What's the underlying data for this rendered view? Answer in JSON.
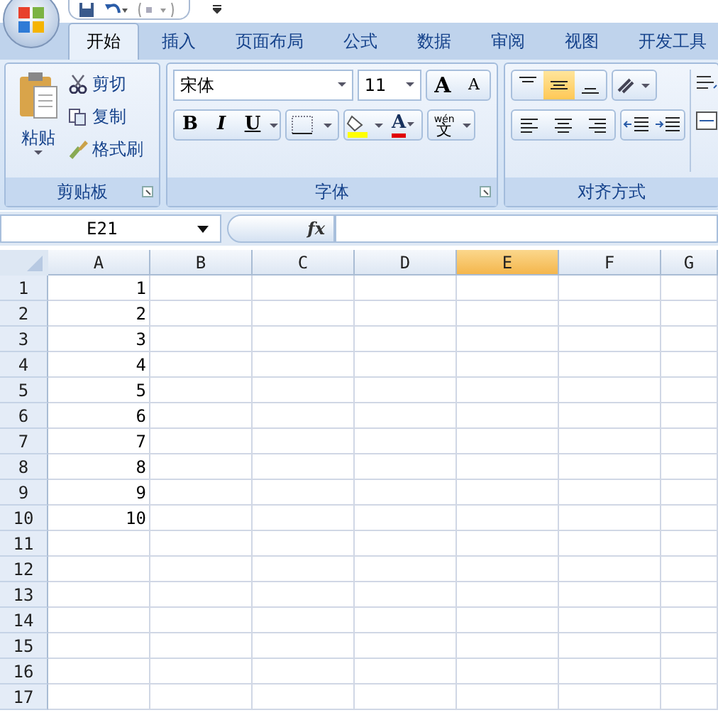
{
  "tabs": [
    {
      "label": "开始",
      "selected": true
    },
    {
      "label": "插入",
      "selected": false
    },
    {
      "label": "页面布局",
      "selected": false
    },
    {
      "label": "公式",
      "selected": false
    },
    {
      "label": "数据",
      "selected": false
    },
    {
      "label": "审阅",
      "selected": false
    },
    {
      "label": "视图",
      "selected": false
    },
    {
      "label": "开发工具",
      "selected": false
    }
  ],
  "clipboard": {
    "paste_label": "粘贴",
    "commands": [
      {
        "kind": "cut",
        "label": "剪切"
      },
      {
        "kind": "copy",
        "label": "复制"
      },
      {
        "kind": "painter",
        "label": "格式刷"
      }
    ],
    "title": "剪贴板"
  },
  "font": {
    "font_name": "宋体",
    "font_size": "11",
    "grow_label": "A",
    "shrink_label": "A",
    "styles": [
      {
        "kind": "bold",
        "label": "B"
      },
      {
        "kind": "italic",
        "label": "I"
      },
      {
        "kind": "underline",
        "label": "U"
      }
    ],
    "font_color_label": "A",
    "phonetic": {
      "ruby": "wén",
      "base": "文"
    },
    "title": "字体"
  },
  "alignment": {
    "vertical": [
      {
        "kind": "top",
        "selected": false
      },
      {
        "kind": "middle",
        "selected": true
      },
      {
        "kind": "bottom",
        "selected": false
      }
    ],
    "horizontal": [
      {
        "kind": "left"
      },
      {
        "kind": "center"
      },
      {
        "kind": "right"
      }
    ],
    "title": "对齐方式"
  },
  "formula_bar": {
    "name_box": "E21",
    "fx_label": "fx"
  },
  "sheet": {
    "columns": [
      {
        "label": "A",
        "selected": false
      },
      {
        "label": "B",
        "selected": false
      },
      {
        "label": "C",
        "selected": false
      },
      {
        "label": "D",
        "selected": false
      },
      {
        "label": "E",
        "selected": true
      },
      {
        "label": "F",
        "selected": false
      },
      {
        "label": "G",
        "selected": false
      }
    ],
    "rows": [
      {
        "header": "1",
        "cells": [
          "1"
        ]
      },
      {
        "header": "2",
        "cells": [
          "2"
        ]
      },
      {
        "header": "3",
        "cells": [
          "3"
        ]
      },
      {
        "header": "4",
        "cells": [
          "4"
        ]
      },
      {
        "header": "5",
        "cells": [
          "5"
        ]
      },
      {
        "header": "6",
        "cells": [
          "6"
        ]
      },
      {
        "header": "7",
        "cells": [
          "7"
        ]
      },
      {
        "header": "8",
        "cells": [
          "8"
        ]
      },
      {
        "header": "9",
        "cells": [
          "9"
        ]
      },
      {
        "header": "10",
        "cells": [
          "10"
        ]
      },
      {
        "header": "11",
        "cells": []
      },
      {
        "header": "12",
        "cells": []
      },
      {
        "header": "13",
        "cells": []
      },
      {
        "header": "14",
        "cells": []
      },
      {
        "header": "15",
        "cells": []
      },
      {
        "header": "16",
        "cells": []
      },
      {
        "header": "17",
        "cells": []
      }
    ]
  }
}
